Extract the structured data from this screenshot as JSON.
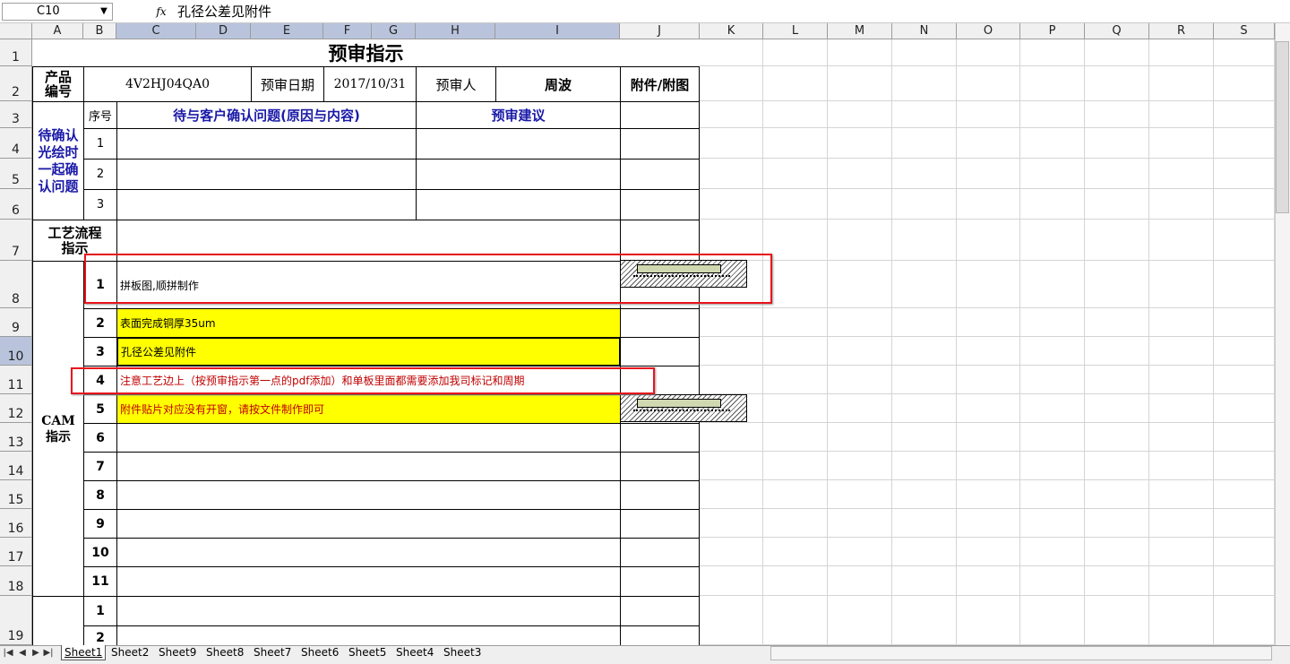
{
  "formula_bar": {
    "cell_ref": "C10",
    "dropdown_icon": "▼",
    "fx_label": "fx",
    "content": "孔径公差见附件"
  },
  "columns": [
    "A",
    "B",
    "C",
    "D",
    "E",
    "F",
    "G",
    "H",
    "I",
    "J",
    "K",
    "L",
    "M",
    "N",
    "O",
    "P",
    "Q",
    "R",
    "S"
  ],
  "rows": [
    "1",
    "2",
    "3",
    "4",
    "5",
    "6",
    "7",
    "8",
    "9",
    "10",
    "11",
    "12",
    "13",
    "14",
    "15",
    "16",
    "17",
    "18",
    "19"
  ],
  "sheet": {
    "title": "预审指示",
    "product_no_label": "产品编号",
    "product_no": "4V2HJ04QA0",
    "review_date_label": "预审日期",
    "review_date": "2017/10/31",
    "reviewer_label": "预审人",
    "reviewer": "周波",
    "attachment_label": "附件/附图",
    "seq_label": "序号",
    "issues_label": "待与客户确认问题(原因与内容)",
    "suggestion_label": "预审建议",
    "confirm_label": "待确认光绘时一起确认问题",
    "confirm_rows": [
      "1",
      "2",
      "3"
    ],
    "process_label": "工艺流程指示",
    "cam_label": "CAM指示",
    "cam_items": [
      {
        "no": "1",
        "text": "拼板图,顺拼制作"
      },
      {
        "no": "2",
        "text": "表面完成铜厚35um"
      },
      {
        "no": "3",
        "text": "孔径公差见附件"
      },
      {
        "no": "4",
        "text": "注意工艺边上（按预审指示第一点的pdf添加）和单板里面都需要添加我司标记和周期"
      },
      {
        "no": "5",
        "text": "附件贴片对应没有开窗，请按文件制作即可"
      },
      {
        "no": "6",
        "text": ""
      },
      {
        "no": "7",
        "text": ""
      },
      {
        "no": "8",
        "text": ""
      },
      {
        "no": "9",
        "text": ""
      },
      {
        "no": "10",
        "text": ""
      },
      {
        "no": "11",
        "text": ""
      }
    ],
    "next_section_rows": [
      "1",
      "2"
    ]
  },
  "tabs": [
    "Sheet1",
    "Sheet2",
    "Sheet9",
    "Sheet8",
    "Sheet7",
    "Sheet6",
    "Sheet5",
    "Sheet4",
    "Sheet3"
  ],
  "nav_buttons": [
    "|◀",
    "◀",
    "▶",
    "▶|"
  ],
  "colors": {
    "highlight": "#ffff00",
    "annotation": "#e8141c",
    "header_text": "#1a1aa8",
    "selected_header": "#b9c4dc"
  }
}
